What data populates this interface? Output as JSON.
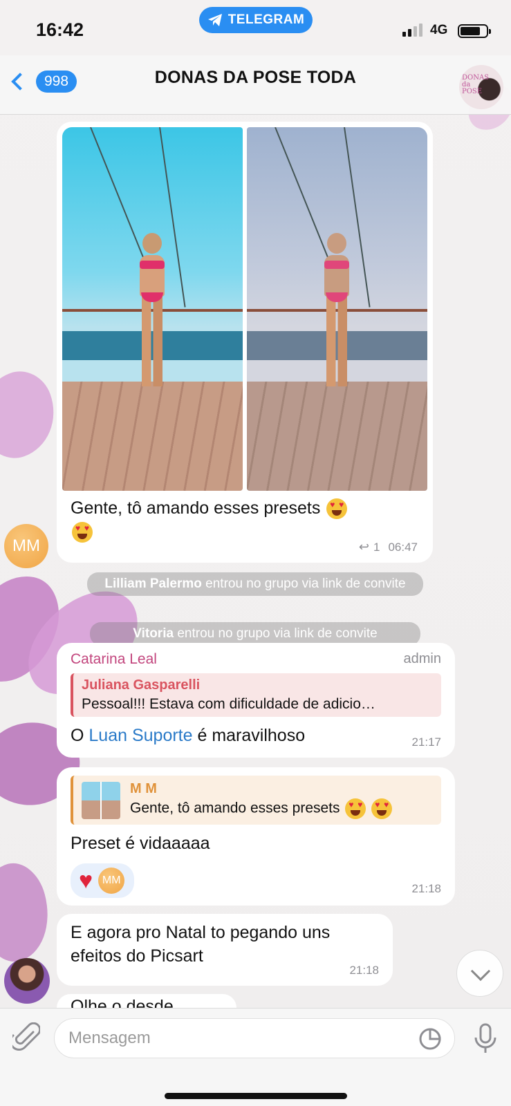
{
  "status_bar": {
    "time": "16:42",
    "banner": "TELEGRAM",
    "network": "4G"
  },
  "header": {
    "back_count": "998",
    "title": "DONAS DA POSE TODA"
  },
  "messages": {
    "photo_msg": {
      "text": "Gente, tô amando esses presets",
      "replies": "1",
      "time": "06:47"
    },
    "sender_avatar": "MM",
    "service": [
      {
        "name": "Lilliam Palermo",
        "text": " entrou no grupo via link de convite"
      },
      {
        "name": "Vitoria",
        "text": " entrou no grupo via link de convite"
      }
    ],
    "admin_msg": {
      "sender": "Catarina Leal",
      "tag": "admin",
      "quote_name": "Juliana Gasparelli",
      "quote_text": "Pessoal!!! Estava com dificuldade de adicio…",
      "text_before": "O ",
      "link": "Luan Suporte",
      "text_after": " é maravilhoso",
      "time": "21:17"
    },
    "reply_msg": {
      "quote_name": "M M",
      "quote_text": "Gente, tô amando esses presets",
      "text": "Preset é vidaaaaa",
      "reaction_user": "MM",
      "time": "21:18"
    },
    "last_msg": {
      "line1": "E agora pro Natal to pegando uns",
      "line2": "efeitos do Picsart",
      "time": "21:18"
    },
    "partial_text": "Olhe o desde"
  },
  "input": {
    "placeholder": "Mensagem"
  },
  "colors": {
    "accent": "#2a8ef2",
    "admin_sender": "#c2457d",
    "quote_red": "#d9535f",
    "quote_orange": "#e0923a"
  }
}
